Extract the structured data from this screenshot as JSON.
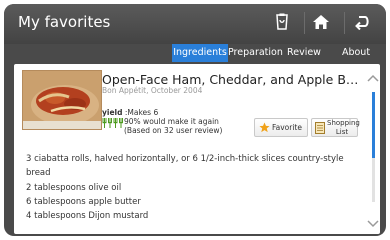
{
  "header": {
    "title": "My favorites",
    "icons": [
      "grocery-list-icon",
      "home-icon",
      "back-icon"
    ]
  },
  "tabs": [
    {
      "label": "Ingredients",
      "active": true
    },
    {
      "label": "Preparation",
      "active": false
    },
    {
      "label": "Review",
      "active": false
    },
    {
      "label": "About",
      "active": false
    }
  ],
  "recipe": {
    "title": "Open-Face Ham, Cheddar, and Apple Butter Sand...",
    "source": "Bon Appétit, October 2004",
    "yield_label": "yield",
    "yield_value": ":Makes 6",
    "rating_line1": "90% would make it again",
    "rating_line2": "(Based on 32 user review)",
    "rating_percent": 90
  },
  "buttons": {
    "favorite": "Favorite",
    "shopping_line1": "Shopping",
    "shopping_line2": "List"
  },
  "ingredients": [
    "3 ciabatta rolls, halved horizontally, or 6 1/2-inch-thick slices country-style",
    "bread",
    "2 tablespoons olive oil",
    "6 tablespoons apple butter",
    "4 tablespoons Dijon mustard"
  ],
  "colors": {
    "accent": "#2a7fd9",
    "header": "#4a4a4a",
    "rating_green": "#4c9a1e",
    "star": "#f0a21a"
  },
  "scroll": {
    "position_fraction": 0
  }
}
